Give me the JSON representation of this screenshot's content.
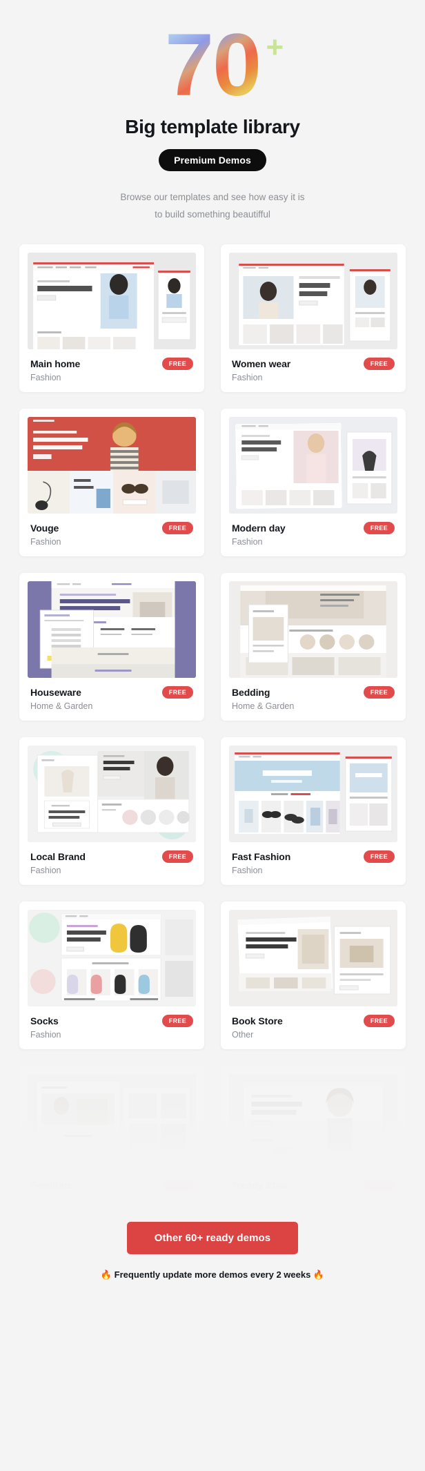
{
  "hero": {
    "number": "70",
    "plus": "+",
    "title": "Big template library",
    "badge": "Premium Demos",
    "desc_line1": "Browse our templates and see how easy it is",
    "desc_line2": "to build something beautifful"
  },
  "colors": {
    "page_bg": "#f4f4f4",
    "card_bg": "#ffffff",
    "accent_red": "#dc4343",
    "free_badge": "#e24b4b",
    "title_dark": "#14181c",
    "muted": "#8b8f94",
    "badge_black": "#0d0d0d"
  },
  "free_label": "FREE",
  "demos": [
    {
      "title": "Main home",
      "category": "Fashion",
      "badge": "FREE",
      "faded": false
    },
    {
      "title": "Women wear",
      "category": "Fashion",
      "badge": "FREE",
      "faded": false
    },
    {
      "title": "Vouge",
      "category": "Fashion",
      "badge": "FREE",
      "faded": false
    },
    {
      "title": "Modern day",
      "category": "Fashion",
      "badge": "FREE",
      "faded": false
    },
    {
      "title": "Houseware",
      "category": "Home & Garden",
      "badge": "FREE",
      "faded": false
    },
    {
      "title": "Bedding",
      "category": "Home & Garden",
      "badge": "FREE",
      "faded": false
    },
    {
      "title": "Local Brand",
      "category": "Fashion",
      "badge": "FREE",
      "faded": false
    },
    {
      "title": "Fast Fashion",
      "category": "Fashion",
      "badge": "FREE",
      "faded": false
    },
    {
      "title": "Socks",
      "category": "Fashion",
      "badge": "FREE",
      "faded": false
    },
    {
      "title": "Book Store",
      "category": "Other",
      "badge": "FREE",
      "faded": false
    },
    {
      "title": "Feminine",
      "category": "",
      "badge": "FREE",
      "faded": true
    },
    {
      "title": "Trendy Style",
      "category": "",
      "badge": "FREE",
      "faded": true
    }
  ],
  "footer": {
    "cta_label": "Other 60+ ready demos",
    "note": "🔥 Frequently update more demos every 2 weeks 🔥"
  }
}
